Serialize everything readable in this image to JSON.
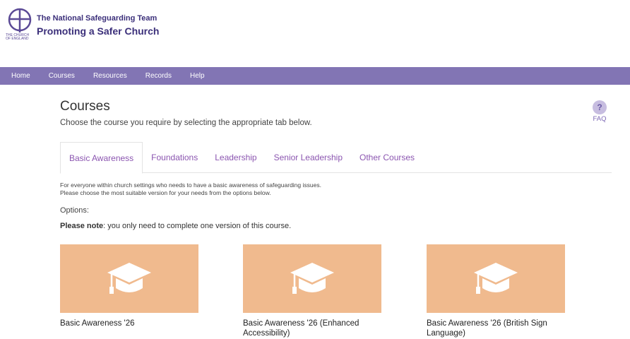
{
  "header": {
    "logo_line1": "The National Safeguarding Team",
    "logo_line2": "Promoting a Safer Church",
    "church_text": "THE CHURCH OF ENGLAND",
    "logo_icon": "church-of-england-cross-icon"
  },
  "nav": {
    "items": [
      {
        "label": "Home"
      },
      {
        "label": "Courses"
      },
      {
        "label": "Resources"
      },
      {
        "label": "Records"
      },
      {
        "label": "Help"
      }
    ]
  },
  "main": {
    "title": "Courses",
    "subtitle": "Choose the course you require by selecting the appropriate tab below.",
    "faq": {
      "icon_text": "?",
      "label": "FAQ"
    },
    "tabs": [
      {
        "label": "Basic Awareness",
        "active": true
      },
      {
        "label": "Foundations"
      },
      {
        "label": "Leadership"
      },
      {
        "label": "Senior Leadership"
      },
      {
        "label": "Other Courses"
      }
    ],
    "description_line1": "For everyone within church settings who needs to have a basic awareness of safeguarding issues.",
    "description_line2": "Please choose the most suitable version for your needs from the options below.",
    "options_label": "Options:",
    "note_bold": "Please note",
    "note_rest": ": you only need to complete one version of this course.",
    "courses": [
      {
        "title": "Basic Awareness '26",
        "icon": "graduation-cap-icon"
      },
      {
        "title": "Basic Awareness '26 (Enhanced Accessibility)",
        "icon": "graduation-cap-icon"
      },
      {
        "title": "Basic Awareness '26 (British Sign Language)",
        "icon": "graduation-cap-icon"
      }
    ]
  },
  "colors": {
    "nav_bg": "#8275b4",
    "tab_text": "#8b55b0",
    "card_bg": "#f0ba8e",
    "logo_text": "#3b2f7a"
  }
}
